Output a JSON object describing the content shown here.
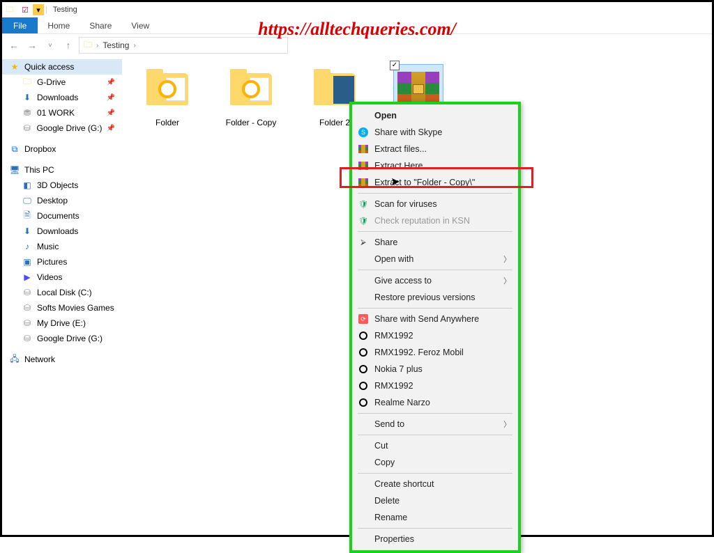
{
  "title": "Testing",
  "watermark": "https://alltechqueries.com/",
  "ribbon": {
    "file": "File",
    "home": "Home",
    "share": "Share",
    "view": "View"
  },
  "breadcrumb": {
    "root": "Testing"
  },
  "sidebar": {
    "quick_access": "Quick access",
    "quick_items": [
      {
        "label": "G-Drive",
        "icon": "folder"
      },
      {
        "label": "Downloads",
        "icon": "download"
      },
      {
        "label": "01 WORK",
        "icon": "drive"
      },
      {
        "label": "Google Drive (G:)",
        "icon": "drive"
      }
    ],
    "dropbox": "Dropbox",
    "this_pc": "This PC",
    "pc_items": [
      {
        "label": "3D Objects",
        "icon": "cube"
      },
      {
        "label": "Desktop",
        "icon": "monitor"
      },
      {
        "label": "Documents",
        "icon": "doc"
      },
      {
        "label": "Downloads",
        "icon": "download"
      },
      {
        "label": "Music",
        "icon": "music"
      },
      {
        "label": "Pictures",
        "icon": "pic"
      },
      {
        "label": "Videos",
        "icon": "vid"
      },
      {
        "label": "Local Disk (C:)",
        "icon": "drive"
      },
      {
        "label": "Softs Movies Games",
        "icon": "drive"
      },
      {
        "label": "My Drive (E:)",
        "icon": "drive"
      },
      {
        "label": "Google Drive (G:)",
        "icon": "drive"
      }
    ],
    "network": "Network"
  },
  "files": [
    {
      "label": "Folder",
      "type": "folder-ring"
    },
    {
      "label": "Folder - Copy",
      "type": "folder-ring"
    },
    {
      "label": "Folder 2",
      "type": "folder-blue"
    },
    {
      "label": "",
      "type": "rar",
      "selected": true
    }
  ],
  "context_menu": {
    "open": "Open",
    "skype": "Share with Skype",
    "extract_files": "Extract files...",
    "extract_here": "Extract Here",
    "extract_to": "Extract to \"Folder - Copy\\\"",
    "scan_virus": "Scan for viruses",
    "check_ksn": "Check reputation in KSN",
    "share": "Share",
    "open_with": "Open with",
    "give_access": "Give access to",
    "restore": "Restore previous versions",
    "send_anywhere": "Share with Send Anywhere",
    "dev1": "RMX1992",
    "dev2": "RMX1992. Feroz Mobil",
    "dev3": "Nokia 7 plus",
    "dev4": "RMX1992",
    "dev5": "Realme Narzo",
    "send_to": "Send to",
    "cut": "Cut",
    "copy": "Copy",
    "shortcut": "Create shortcut",
    "delete": "Delete",
    "rename": "Rename",
    "properties": "Properties"
  }
}
